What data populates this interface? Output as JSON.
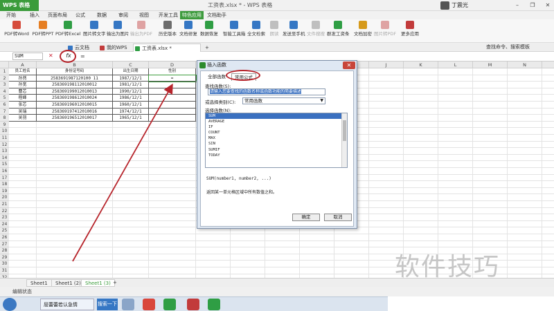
{
  "app": {
    "logo": "WPS 表格",
    "doc_title": "工资表.xlsx * - WPS 表格",
    "user": "丁震光",
    "window_controls": [
      "–",
      "❐",
      "✕"
    ]
  },
  "menu": [
    "开始",
    "插入",
    "页面布局",
    "公式",
    "数据",
    "审阅",
    "视图",
    "开发工具",
    "特色应用",
    "文档助手"
  ],
  "menu_active": "特色应用",
  "ribbon": [
    {
      "label": "PDF转Word",
      "color": "#d64b3b",
      "enabled": true
    },
    {
      "label": "PDF转PPT",
      "color": "#e67e22",
      "enabled": true
    },
    {
      "label": "PDF转Excel",
      "color": "#2f9e44",
      "enabled": true
    },
    {
      "label": "图片转文字",
      "color": "#3577c4",
      "enabled": true
    },
    {
      "label": "输出为图片",
      "color": "#3577c4",
      "enabled": true
    },
    {
      "label": "输出为PDF",
      "color": "#c23b3b",
      "enabled": false
    },
    {
      "label": "历史版本",
      "color": "#6d6d6d",
      "enabled": true
    },
    {
      "label": "文档修复",
      "color": "#3577c4",
      "enabled": true
    },
    {
      "label": "数据恢复",
      "color": "#2f9e44",
      "enabled": true
    },
    {
      "label": "智能工具箱",
      "color": "#3577c4",
      "enabled": true
    },
    {
      "label": "全文检索",
      "color": "#3577c4",
      "enabled": true
    },
    {
      "label": "朗读",
      "color": "#7a7a7a",
      "enabled": false
    },
    {
      "label": "发送至手机",
      "color": "#3577c4",
      "enabled": true
    },
    {
      "label": "文件搜搜",
      "color": "#7a7a7a",
      "enabled": false
    },
    {
      "label": "群发工资条",
      "color": "#2f9e44",
      "enabled": true
    },
    {
      "label": "文档加密",
      "color": "#d69a1b",
      "enabled": true
    },
    {
      "label": "图片转PDF",
      "color": "#c23b3b",
      "enabled": false
    },
    {
      "label": "更多应用",
      "color": "#c23b3b",
      "enabled": true
    }
  ],
  "tabs": {
    "docs": [
      {
        "label": "云文档",
        "color": "#3577c4",
        "active": false
      },
      {
        "label": "我的WPS",
        "color": "#c23b3b",
        "active": false
      },
      {
        "label": "工资表.xlsx *",
        "color": "#2f9e44",
        "active": true
      }
    ],
    "new_tab": "+",
    "search_cmd": "查找命令、搜索模板"
  },
  "formula_bar": {
    "cell_ref": "SUM",
    "fx": "fx",
    "cancel": "✕",
    "confirm": "✓",
    "value": "="
  },
  "sheet": {
    "columns": [
      "A",
      "B",
      "C",
      "D",
      "E",
      "F",
      "G",
      "H",
      "I",
      "J",
      "K",
      "L",
      "M",
      "N",
      "O"
    ],
    "header_row": [
      "员工姓名",
      "身份证号码",
      "出生日期",
      "性别"
    ],
    "rows": [
      [
        "孙然",
        "2583691987120100 11",
        "1987/12/1",
        "="
      ],
      [
        "孙宽",
        "258369198112010012",
        "1981/12/1",
        ""
      ],
      [
        "曹芯",
        "258369199012010013",
        "1990/12/1",
        ""
      ],
      [
        "程峰",
        "258369198612010024",
        "1986/12/1",
        ""
      ],
      [
        "张芯",
        "258369196012010015",
        "1960/12/1",
        ""
      ],
      [
        "吴瑞",
        "258369197412010016",
        "1974/12/1",
        ""
      ],
      [
        "吴羽",
        "258369196512010017",
        "1965/12/1",
        ""
      ]
    ],
    "row_numbers": [
      "1",
      "2",
      "3",
      "4",
      "5",
      "6",
      "7",
      "8",
      "9",
      "10",
      "11",
      "12",
      "13",
      "14",
      "15",
      "16",
      "17",
      "18",
      "19",
      "20",
      "21",
      "22",
      "23",
      "24",
      "25",
      "26",
      "27",
      "28",
      "29",
      "30",
      "31",
      "32"
    ]
  },
  "sheet_tabs": [
    "Sheet1",
    "Sheet1 (2)",
    "Sheet1 (3)"
  ],
  "sheet_tab_active": "Sheet1 (3)",
  "sheet_tab_add": "+",
  "status": "编辑状态",
  "taskbar": {
    "ie_text": "屈蕾蕾若认急情",
    "search_btn": "搜索一下"
  },
  "watermark": "软件技巧",
  "dialog": {
    "title": "插入函数",
    "tabs": [
      "全部函数",
      "常用公式"
    ],
    "search_label": "查找函数(S):",
    "search_value": "请输入您要查找的函数名称或函数功能的简要描述",
    "category_label": "或选择类别(C):",
    "category_value": "常用函数",
    "select_label": "选择函数(N):",
    "functions": [
      "SUM",
      "AVERAGE",
      "IF",
      "COUNT",
      "MAX",
      "SIN",
      "SUMIF",
      "TODAY"
    ],
    "selected_function": "SUM",
    "signature": "SUM(number1, number2, ...)",
    "description": "返回某一单元格区域中所有数值之和。",
    "ok": "确定",
    "cancel": "取消"
  },
  "annotation_color": "#b7242b"
}
